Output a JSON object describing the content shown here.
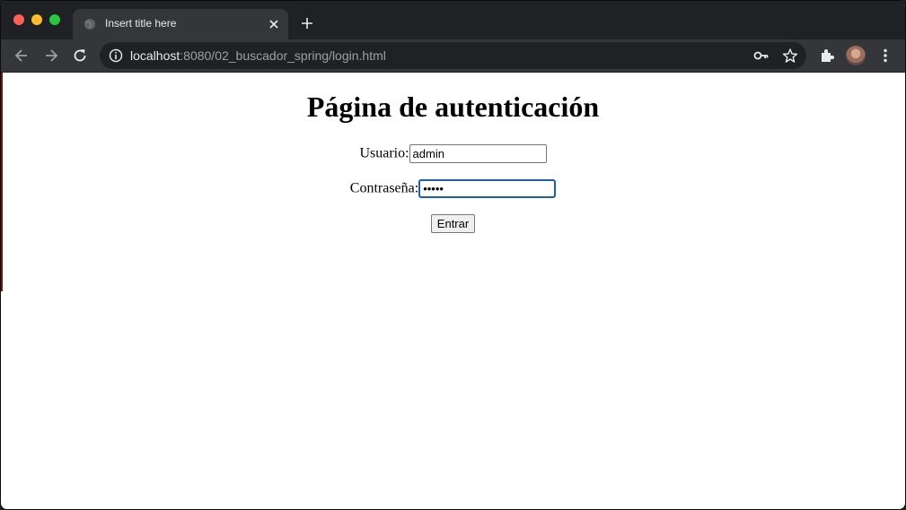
{
  "browser": {
    "tab_title": "Insert title here",
    "url_host": "localhost",
    "url_rest": ":8080/02_buscador_spring/login.html",
    "icons": [
      "globe-icon",
      "close-icon",
      "plus-icon",
      "back-arrow-icon",
      "forward-arrow-icon",
      "reload-icon",
      "info-icon",
      "key-icon",
      "star-icon",
      "extensions-icon",
      "avatar",
      "more-menu-icon"
    ]
  },
  "page": {
    "heading": "Página de autenticación",
    "user_label": "Usuario:",
    "user_value": "admin",
    "password_label": "Contraseña:",
    "password_value": "•••••",
    "submit_label": "Entrar"
  },
  "colors": {
    "tabstrip": "#202124",
    "toolbar": "#35363a",
    "focus_border": "#1a5fb4"
  }
}
